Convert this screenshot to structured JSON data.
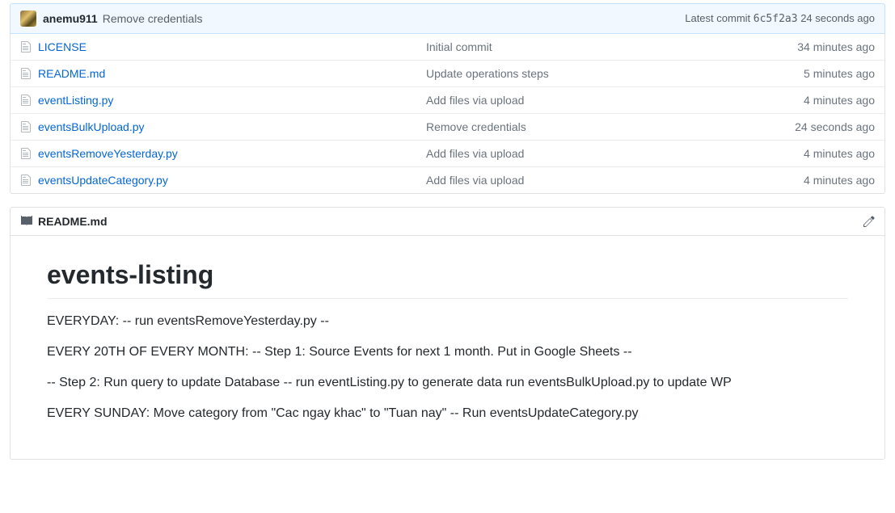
{
  "commit_header": {
    "author": "anemu911",
    "message": "Remove credentials",
    "latest_label": "Latest commit",
    "sha": "6c5f2a3",
    "time": "24 seconds ago"
  },
  "files": [
    {
      "name": "LICENSE",
      "message": "Initial commit",
      "time": "34 minutes ago"
    },
    {
      "name": "README.md",
      "message": "Update operations steps",
      "time": "5 minutes ago"
    },
    {
      "name": "eventListing.py",
      "message": "Add files via upload",
      "time": "4 minutes ago"
    },
    {
      "name": "eventsBulkUpload.py",
      "message": "Remove credentials",
      "time": "24 seconds ago"
    },
    {
      "name": "eventsRemoveYesterday.py",
      "message": "Add files via upload",
      "time": "4 minutes ago"
    },
    {
      "name": "eventsUpdateCategory.py",
      "message": "Add files via upload",
      "time": "4 minutes ago"
    }
  ],
  "readme": {
    "filename": "README.md",
    "title": "events-listing",
    "paragraphs": [
      "EVERYDAY: -- run eventsRemoveYesterday.py --",
      "EVERY 20TH OF EVERY MONTH: -- Step 1: Source Events for next 1 month. Put in Google Sheets --",
      "-- Step 2: Run query to update Database -- run eventListing.py to generate data run eventsBulkUpload.py to update WP",
      "EVERY SUNDAY: Move category from \"Cac ngay khac\" to \"Tuan nay\" -- Run eventsUpdateCategory.py"
    ]
  }
}
